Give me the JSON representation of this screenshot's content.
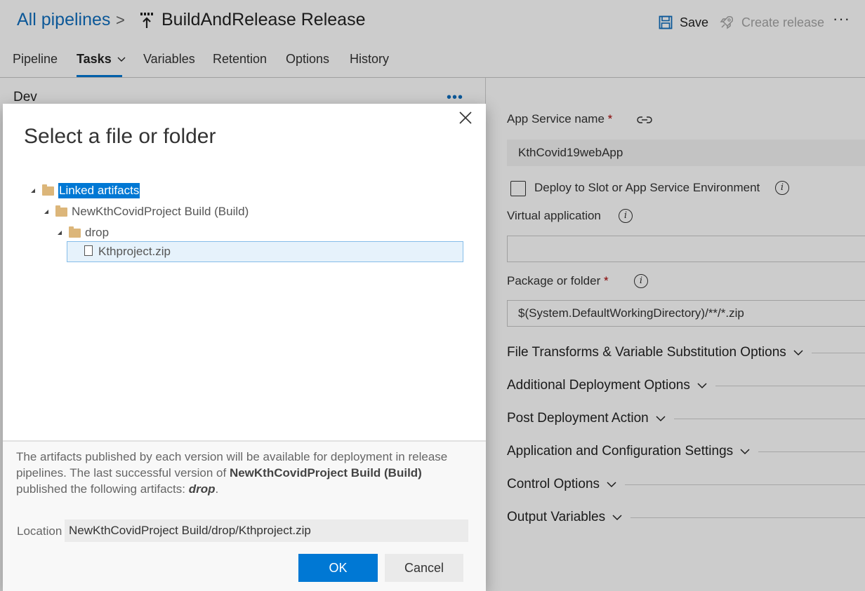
{
  "header": {
    "breadcrumb_root": "All pipelines",
    "breadcrumb_sep": ">",
    "title": "BuildAndRelease Release",
    "save_label": "Save",
    "create_release_label": "Create release",
    "more_label": "···"
  },
  "tabs": [
    {
      "label": "Pipeline"
    },
    {
      "label": "Tasks"
    },
    {
      "label": "Variables"
    },
    {
      "label": "Retention"
    },
    {
      "label": "Options"
    },
    {
      "label": "History"
    }
  ],
  "left": {
    "stage_name": "Dev",
    "more_label": "•••"
  },
  "form": {
    "app_service_label": "App Service name",
    "required_mark": "*",
    "app_service_value": "KthCovid19webApp",
    "deploy_slot_label": "Deploy to Slot or App Service Environment",
    "virtual_app_label": "Virtual application",
    "virtual_app_value": "",
    "package_label": "Package or folder",
    "package_value": "$(System.DefaultWorkingDirectory)/**/*.zip",
    "info_glyph": "i",
    "sections": [
      "File Transforms & Variable Substitution Options",
      "Additional Deployment Options",
      "Post Deployment Action",
      "Application and Configuration Settings",
      "Control Options",
      "Output Variables"
    ]
  },
  "dialog": {
    "title": "Select a file or folder",
    "tree": {
      "root": "Linked artifacts",
      "build": "NewKthCovidProject Build (Build)",
      "folder": "drop",
      "file": "Kthproject.zip"
    },
    "desc_part1": "The artifacts published by each version will be available for deployment in release pipelines. The last successful version of ",
    "desc_bold": "NewKthCovidProject Build (Build)",
    "desc_part2": " published the following artifacts: ",
    "desc_artifact": "drop",
    "desc_end": ".",
    "location_label": "Location",
    "location_value": "NewKthCovidProject Build/drop/Kthproject.zip",
    "ok_label": "OK",
    "cancel_label": "Cancel"
  },
  "colors": {
    "accent": "#0078d4",
    "link": "#106ebe",
    "required": "#a80000",
    "folder": "#dcb67a"
  }
}
